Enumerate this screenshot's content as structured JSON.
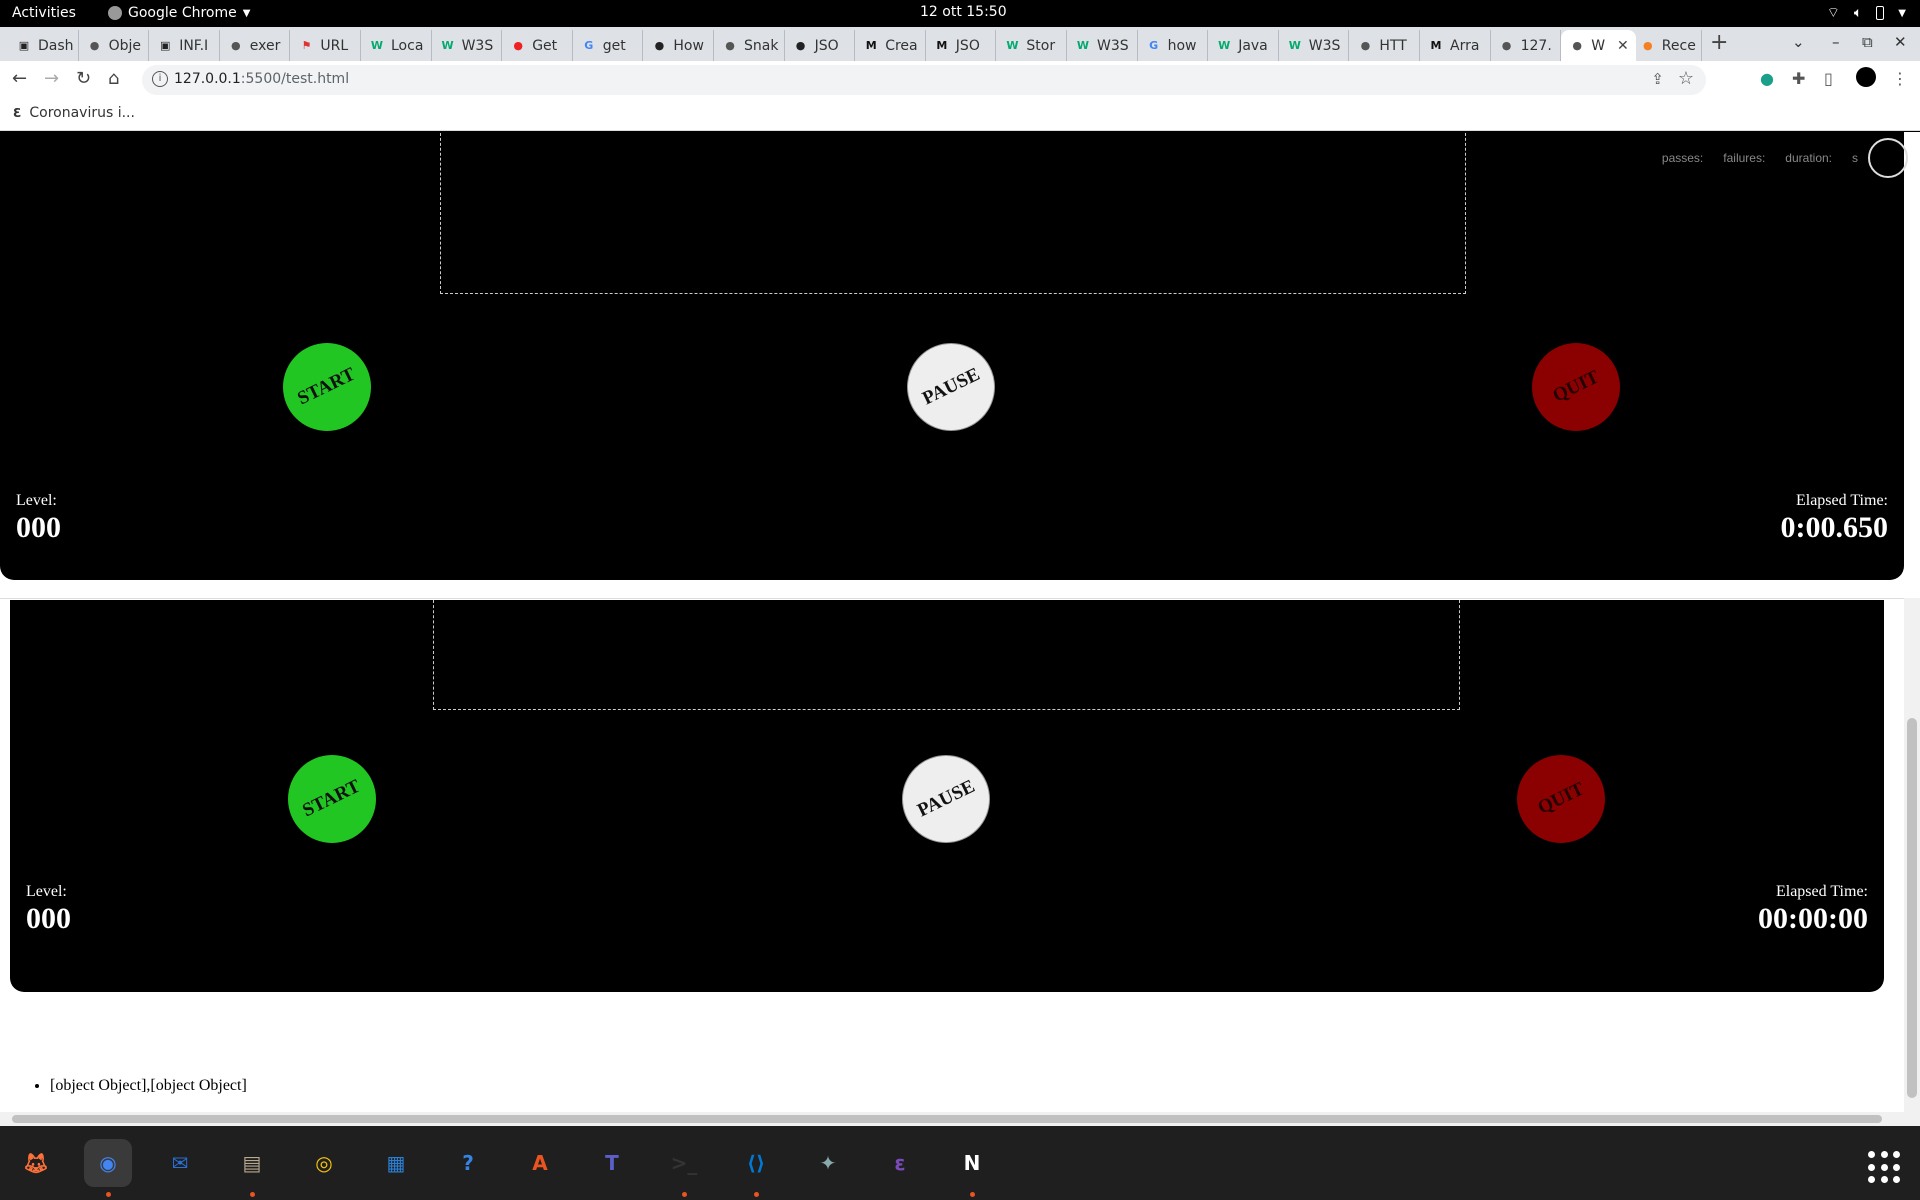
{
  "topbar": {
    "activities": "Activities",
    "app": "Google Chrome",
    "clock": "12 ott  15:50"
  },
  "tabs": [
    {
      "label": "Dash",
      "icon": "dash-icon",
      "color": "#222"
    },
    {
      "label": "Obje",
      "icon": "globe-icon",
      "color": "#555"
    },
    {
      "label": "INF.I",
      "icon": "dash-icon",
      "color": "#222"
    },
    {
      "label": "exer",
      "icon": "globe-icon",
      "color": "#555"
    },
    {
      "label": "URL",
      "icon": "figure-icon",
      "color": "#d33"
    },
    {
      "label": "Loca",
      "icon": "w3-icon",
      "color": "#04aa6d"
    },
    {
      "label": "W3S",
      "icon": "w3-icon",
      "color": "#04aa6d"
    },
    {
      "label": "Get",
      "icon": "cube-icon",
      "color": "#e22"
    },
    {
      "label": "get",
      "icon": "google-icon",
      "color": "#4285f4"
    },
    {
      "label": "How",
      "icon": "diamond-icon",
      "color": "#222"
    },
    {
      "label": "Snak",
      "icon": "globe-icon",
      "color": "#555"
    },
    {
      "label": "JSO",
      "icon": "circle-icon",
      "color": "#222"
    },
    {
      "label": "Crea",
      "icon": "medium-icon",
      "color": "#111"
    },
    {
      "label": "JSO",
      "icon": "medium-icon",
      "color": "#111"
    },
    {
      "label": "Stor",
      "icon": "w3-icon",
      "color": "#04aa6d"
    },
    {
      "label": "W3S",
      "icon": "w3-icon",
      "color": "#04aa6d"
    },
    {
      "label": "how",
      "icon": "google-icon",
      "color": "#4285f4"
    },
    {
      "label": "Java",
      "icon": "w3-icon",
      "color": "#04aa6d"
    },
    {
      "label": "W3S",
      "icon": "w3-icon",
      "color": "#04aa6d"
    },
    {
      "label": "HTT",
      "icon": "globe-icon",
      "color": "#555"
    },
    {
      "label": "Arra",
      "icon": "medium-icon",
      "color": "#111"
    },
    {
      "label": "127.",
      "icon": "globe-icon",
      "color": "#555"
    },
    {
      "label": "W",
      "icon": "globe-icon",
      "color": "#555",
      "active": true
    },
    {
      "label": "Rece",
      "icon": "stack-icon",
      "color": "#f48024"
    }
  ],
  "toolbar": {
    "url_host": "127.0.0.1",
    "url_rest": ":5500/test.html"
  },
  "bookmarks": {
    "item": "Coronavirus i..."
  },
  "mocha": {
    "passes": "passes:",
    "failures": "failures:",
    "duration": "duration:",
    "seconds": "s"
  },
  "game1": {
    "start": "START",
    "pause": "PAUSE",
    "quit": "QUIT",
    "level_label": "Level:",
    "level_value": "000",
    "time_label": "Elapsed Time:",
    "time_value": "0:00.650"
  },
  "game2": {
    "start": "START",
    "pause": "PAUSE",
    "quit": "QUIT",
    "level_label": "Level:",
    "level_value": "000",
    "time_label": "Elapsed Time:",
    "time_value": "00:00:00"
  },
  "output": {
    "item": "[object Object],[object Object]"
  },
  "dock": [
    {
      "name": "firefox-icon",
      "color": "#ff7139"
    },
    {
      "name": "chrome-icon",
      "color": "#4285f4"
    },
    {
      "name": "thunderbird-icon",
      "color": "#2a6fd6"
    },
    {
      "name": "files-icon",
      "color": "#b9a98f"
    },
    {
      "name": "rhythmbox-icon",
      "color": "#f5c211"
    },
    {
      "name": "writer-icon",
      "color": "#2a7fd4"
    },
    {
      "name": "help-icon",
      "color": "#3584e4"
    },
    {
      "name": "software-icon",
      "color": "#e95420"
    },
    {
      "name": "teams-icon",
      "color": "#5b5fc7"
    },
    {
      "name": "terminal-icon",
      "color": "#333"
    },
    {
      "name": "vscode-icon",
      "color": "#0078d4"
    },
    {
      "name": "bird-icon",
      "color": "#8aa"
    },
    {
      "name": "emacs-icon",
      "color": "#7a4bb8"
    },
    {
      "name": "notion-icon",
      "color": "#fff"
    }
  ]
}
